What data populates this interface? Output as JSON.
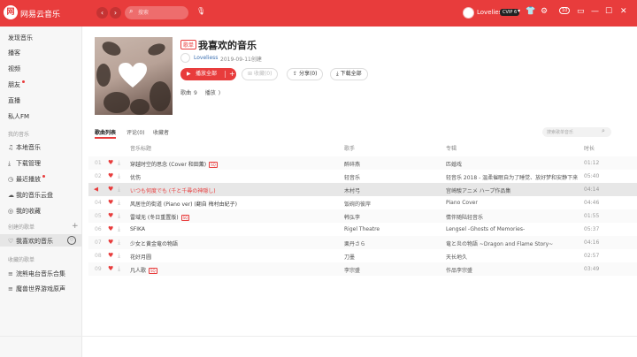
{
  "app": {
    "logo_text": "网",
    "name": "网易云音乐"
  },
  "titlebar": {
    "search_placeholder": "搜索",
    "username": "Loveliess",
    "vip_label": "CVIP 6",
    "notifications_badge": "10"
  },
  "sidebar": {
    "nav": [
      "发现音乐",
      "播客",
      "视频",
      "朋友",
      "直播",
      "私人FM"
    ],
    "my_music_header": "我的音乐",
    "my_music": [
      "本地音乐",
      "下载管理",
      "最近播放",
      "我的音乐云盘",
      "我的收藏"
    ],
    "created_header": "创建的歌单",
    "created": [
      "我喜欢的音乐"
    ],
    "collected_header": "收藏的歌单",
    "collected": [
      "浣熊电台音乐合集",
      "魔兽世界游戏原声"
    ]
  },
  "playlist": {
    "tag": "歌单",
    "title": "我喜欢的音乐",
    "creator": "Loveliess",
    "created": "2019-09-11创建",
    "play_all": "播放全部",
    "favorite": "收藏(0)",
    "share": "分享(0)",
    "download_all": "下载全部",
    "songs_label": "歌曲",
    "songs_count": "9",
    "plays_label": "播放",
    "plays_count": ")"
  },
  "tabs": [
    "歌曲列表",
    "评论(0)",
    "收藏者"
  ],
  "search_playlist_placeholder": "搜索歌单音乐",
  "columns": {
    "title": "音乐标题",
    "artist": "歌手",
    "album": "专辑",
    "duration": "时长"
  },
  "songs": [
    {
      "num": "01",
      "title": "穿越时空的思念 (Cover 和田薫)",
      "sq": "SQ",
      "artist": "醉碎燕",
      "album": "匹婚戏",
      "duration": "01:12"
    },
    {
      "num": "02",
      "title": "优伤",
      "sq": "",
      "artist": "轻音乐",
      "album": "轻音乐 2018 - 温柔催眠自为了睡觉、放好梦和安静下来",
      "duration": "05:40"
    },
    {
      "num": "",
      "title": "いつも何度でも (千と千尋の神隠し)",
      "sq": "",
      "artist": "木村弓",
      "album": "宫崎駿アニメ ハープ作品集",
      "duration": "04:14"
    },
    {
      "num": "04",
      "title": "风居住的街道 (Piano ver) (翻自 梅村由紀子)",
      "sq": "",
      "artist": "饭碗的彼岸",
      "album": "Piano Cover",
      "duration": "04:46"
    },
    {
      "num": "05",
      "title": "雷域无 (冬日重置版)",
      "sq": "SQ",
      "artist": "韩弘李",
      "album": "情伴随陆轻音乐",
      "duration": "01:55"
    },
    {
      "num": "06",
      "title": "SFIKA",
      "sq": "",
      "artist": "Rigel Theatre",
      "album": "Lengsel -Ghosts of Memories-",
      "duration": "05:37"
    },
    {
      "num": "07",
      "title": "少女と黄金竜の物語",
      "sq": "",
      "artist": "栗丹さら",
      "album": "竜と炎の物語 ~Dragon and Flame Story~",
      "duration": "04:16"
    },
    {
      "num": "08",
      "title": "花好月圆",
      "sq": "",
      "artist": "刀墨",
      "album": "天长地久",
      "duration": "02:57"
    },
    {
      "num": "09",
      "title": "凡人歌",
      "sq": "SQ",
      "artist": "李宗盛",
      "album": "作品李宗盛",
      "duration": "03:49"
    }
  ]
}
